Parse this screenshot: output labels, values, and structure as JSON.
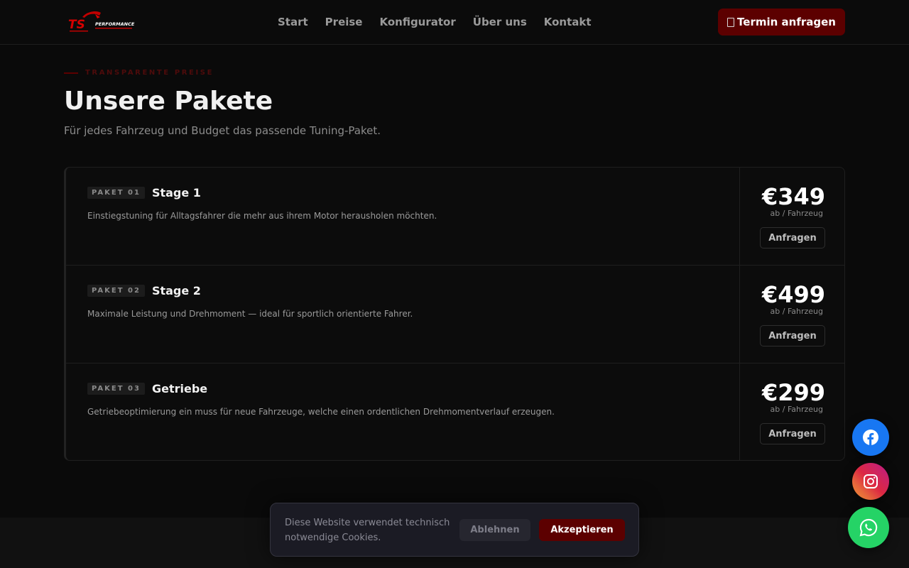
{
  "header": {
    "logo_text": "TS PERFORMANCE",
    "nav": [
      "Start",
      "Preise",
      "Konfigurator",
      "Über uns",
      "Kontakt"
    ],
    "cta_label": "Termin anfragen"
  },
  "section": {
    "eyebrow": "TRANSPARENTE PREISE",
    "title": "Unsere Pakete",
    "subtitle": "Für jedes Fahrzeug und Budget das passende Tuning-Paket."
  },
  "packages": [
    {
      "badge": "PAKET 01",
      "name": "Stage 1",
      "description": "Einstiegstuning für Alltagsfahrer die mehr aus ihrem Motor herausholen möchten.",
      "price": "€349",
      "price_unit": "ab / Fahrzeug",
      "button": "Anfragen"
    },
    {
      "badge": "PAKET 02",
      "name": "Stage 2",
      "description": "Maximale Leistung und Drehmoment — ideal für sportlich orientierte Fahrer.",
      "price": "€499",
      "price_unit": "ab / Fahrzeug",
      "button": "Anfragen"
    },
    {
      "badge": "PAKET 03",
      "name": "Getriebe",
      "description": "Getriebeoptimierung ein muss für neue Fahrzeuge, welche einen ordentlichen Drehmomentverlauf erzeugen.",
      "price": "€299",
      "price_unit": "ab / Fahrzeug",
      "button": "Anfragen"
    }
  ],
  "cookie": {
    "text": "Diese Website verwendet technisch notwendige Cookies.",
    "decline": "Ablehnen",
    "accept": "Akzeptieren"
  },
  "social": {
    "icons": [
      "facebook-icon",
      "instagram-icon",
      "whatsapp-icon"
    ]
  },
  "colors": {
    "accent": "#5c0000",
    "background": "#0a0a0a",
    "facebook": "#1877f2",
    "whatsapp": "#25d366"
  }
}
